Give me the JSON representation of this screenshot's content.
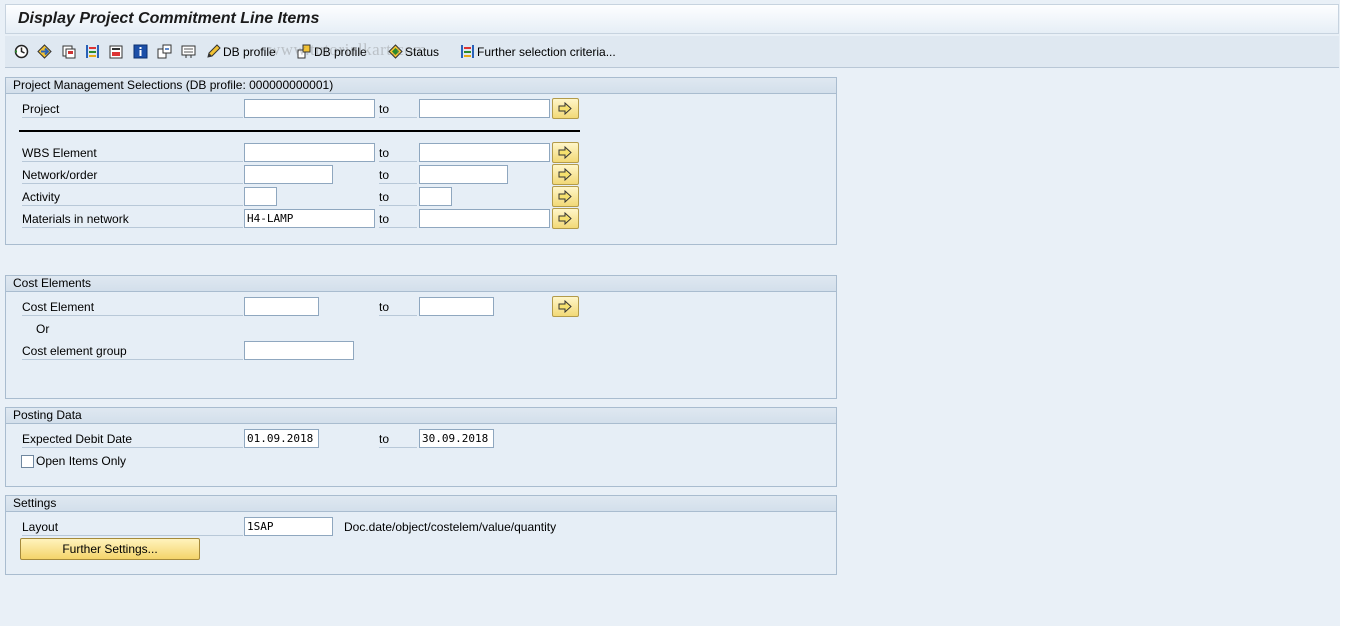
{
  "window": {
    "title": "Display Project Commitment Line Items"
  },
  "toolbar": {
    "icons": [
      "execute-icon",
      "get-variant-icon",
      "save-as-variant-icon",
      "selection-options-icon",
      "delete-selection-icon",
      "info-icon",
      "dynamic-selections-icon",
      "output-parameters-icon"
    ],
    "db_profile_label": "DB profile",
    "db_profile2_label": "DB profile",
    "status_label": "Status",
    "further_selection_label": "Further selection criteria..."
  },
  "watermark": "www.tutorialkart.com",
  "project_management": {
    "header": "Project Management Selections (DB profile: 000000000001)",
    "project": {
      "label": "Project",
      "from": "",
      "to": "",
      "to_label": "to"
    },
    "wbs": {
      "label": "WBS Element",
      "from": "",
      "to": "",
      "to_label": "to"
    },
    "network": {
      "label": "Network/order",
      "from": "",
      "to": "",
      "to_label": "to"
    },
    "activity": {
      "label": "Activity",
      "from": "",
      "to": "",
      "to_label": "to"
    },
    "materials": {
      "label": "Materials in network",
      "from": "H4-LAMP",
      "to": "",
      "to_label": "to"
    }
  },
  "cost_elements": {
    "header": "Cost Elements",
    "cost_element": {
      "label": "Cost Element",
      "from": "",
      "to": "",
      "to_label": "to"
    },
    "or_label": "Or",
    "group": {
      "label": "Cost element group",
      "value": ""
    }
  },
  "posting_data": {
    "header": "Posting Data",
    "debit_date": {
      "label": "Expected Debit Date",
      "from": "01.09.2018",
      "to": "30.09.2018",
      "to_label": "to"
    },
    "open_items": {
      "label": "Open Items Only",
      "checked": false
    }
  },
  "settings": {
    "header": "Settings",
    "layout": {
      "label": "Layout",
      "value": "1SAP",
      "description": "Doc.date/object/costelem/value/quantity"
    },
    "further_settings_label": "Further Settings..."
  },
  "colors": {
    "background": "#e9f0f7",
    "button_yellow": "#f4d46a",
    "group_border": "#a9bccf"
  }
}
